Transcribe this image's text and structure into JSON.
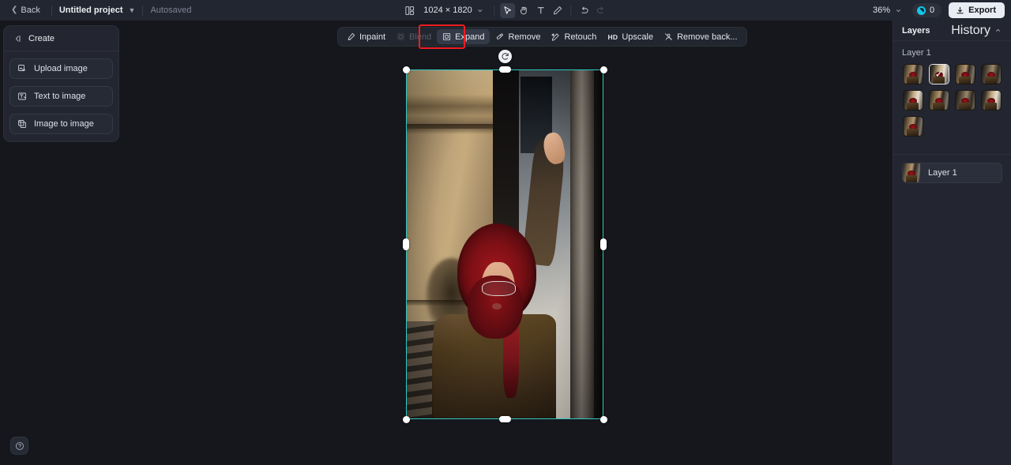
{
  "header": {
    "back_label": "Back",
    "project_name": "Untitled project",
    "save_status": "Autosaved",
    "canvas_size": "1024 × 1820",
    "zoom_level": "36%",
    "credits_count": "0",
    "export_label": "Export",
    "tools": [
      {
        "name": "artboard-icon",
        "label": "Artboard"
      },
      {
        "name": "select-tool",
        "label": "Select",
        "active": true
      },
      {
        "name": "hand-tool",
        "label": "Hand"
      },
      {
        "name": "text-tool",
        "label": "Text"
      },
      {
        "name": "brush-tool",
        "label": "Brush"
      },
      {
        "name": "undo-button",
        "label": "Undo"
      },
      {
        "name": "redo-button",
        "label": "Redo",
        "disabled": true
      }
    ]
  },
  "left_panel": {
    "title": "Create",
    "items": [
      {
        "label": "Upload image",
        "icon": "upload-image-icon"
      },
      {
        "label": "Text to image",
        "icon": "text-to-image-icon"
      },
      {
        "label": "Image to image",
        "icon": "image-to-image-icon"
      }
    ]
  },
  "action_toolbar": {
    "items": [
      {
        "label": "Inpaint",
        "icon": "inpaint-icon",
        "state": "normal"
      },
      {
        "label": "Blend",
        "icon": "blend-icon",
        "state": "disabled"
      },
      {
        "label": "Expand",
        "icon": "expand-icon",
        "state": "active"
      },
      {
        "label": "Remove",
        "icon": "remove-icon",
        "state": "normal"
      },
      {
        "label": "Retouch",
        "icon": "retouch-icon",
        "state": "normal"
      },
      {
        "label": "Upscale",
        "icon": "hd-icon",
        "state": "normal",
        "badge": "HD"
      },
      {
        "label": "Remove back...",
        "icon": "remove-background-icon",
        "state": "normal"
      }
    ],
    "highlighted_item": "Expand"
  },
  "right_panel": {
    "tabs": {
      "layers": "Layers",
      "history": "History"
    },
    "section_title": "Layer 1",
    "thumbnail_count": 9,
    "selected_thumbnail_index": 1,
    "layer": {
      "name": "Layer 1"
    }
  },
  "canvas": {
    "selection": {
      "rotate_handle": "rotate-icon"
    }
  },
  "help": {
    "label": "Help"
  },
  "colors": {
    "accent_selection": "#2ec9c0",
    "annotation_red": "#f01c22",
    "credit_cyan": "#16c5e8",
    "panel_bg": "#232630",
    "header_bg": "#222630",
    "canvas_bg": "#15171c"
  }
}
